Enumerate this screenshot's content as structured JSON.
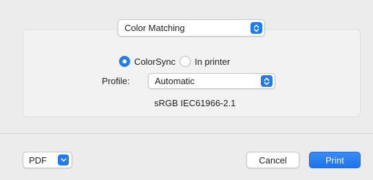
{
  "section_popup": {
    "value": "Color Matching"
  },
  "color_matching": {
    "options": [
      {
        "label": "ColorSync",
        "selected": true
      },
      {
        "label": "In printer",
        "selected": false
      }
    ],
    "profile_label": "Profile:",
    "profile_value": "Automatic",
    "profile_name": "sRGB IEC61966-2.1"
  },
  "footer": {
    "pdf_label": "PDF",
    "cancel_label": "Cancel",
    "print_label": "Print"
  },
  "colors": {
    "accent": "#1f7bf0",
    "group_background": "#f2f2f2"
  },
  "icons": {
    "popup_stepper": "up-down-chevron-icon",
    "pdf_menu": "chevron-down-icon"
  }
}
